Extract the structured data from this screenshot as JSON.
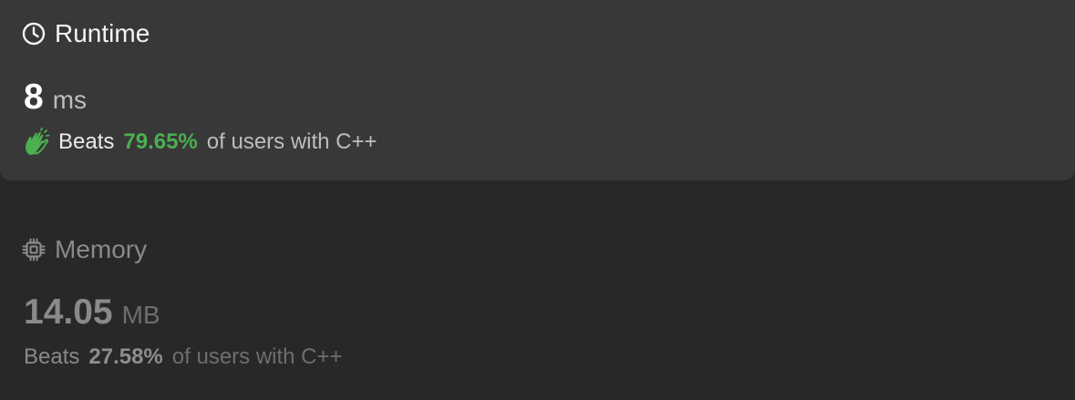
{
  "runtime": {
    "title": "Runtime",
    "icon": "clock-icon",
    "value": "8",
    "unit": "ms",
    "beats_label": "Beats",
    "beats_percent": "79.65%",
    "beats_suffix": "of users with C++",
    "beats_icon": "clap-icon",
    "accent_color": "#4caf50"
  },
  "memory": {
    "title": "Memory",
    "icon": "chip-icon",
    "value": "14.05",
    "unit": "MB",
    "beats_label": "Beats",
    "beats_percent": "27.58%",
    "beats_suffix": "of users with C++"
  }
}
